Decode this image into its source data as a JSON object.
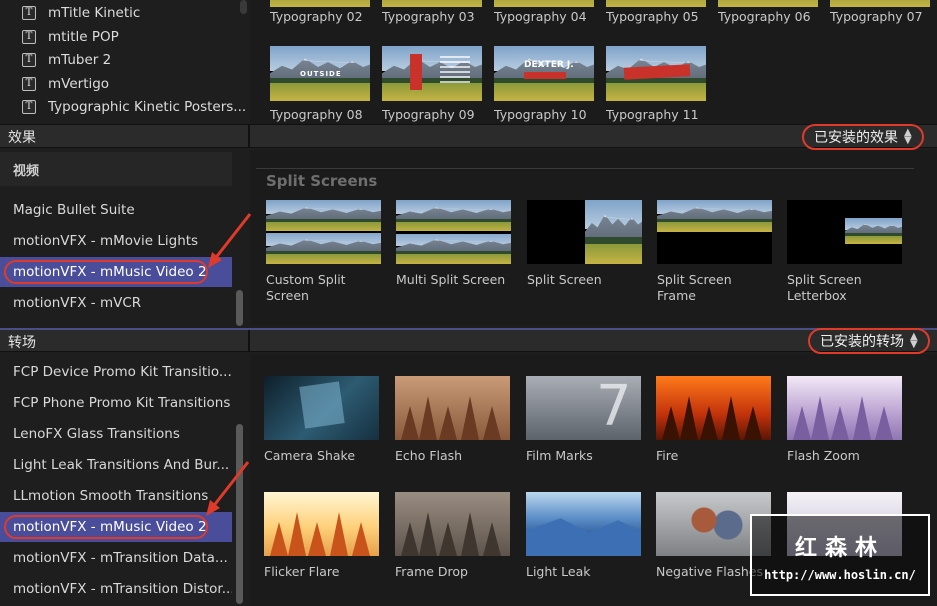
{
  "colors": {
    "accent_red": "#e03a2a",
    "selection": "#4a4e9a",
    "panel": "#1b1b1b",
    "section_bar": "#2b2b2b"
  },
  "titles_list": [
    {
      "icon": "T",
      "label": "mTitle Kinetic"
    },
    {
      "icon": "T",
      "label": "mtitle POP"
    },
    {
      "icon": "T",
      "label": "mTuber 2"
    },
    {
      "icon": "T",
      "label": "mVertigo"
    },
    {
      "icon": "T",
      "label": "Typographic Kinetic Posters..."
    }
  ],
  "typography_row1": [
    "Typography 02",
    "Typography 03",
    "Typography 04",
    "Typography 05",
    "Typography 06",
    "Typography 07"
  ],
  "typography_row2": [
    {
      "label": "Typography 08",
      "overlay": "OUTSIDE"
    },
    {
      "label": "Typography 09",
      "overlay": ""
    },
    {
      "label": "Typography 10",
      "overlay": "DEXTER J."
    },
    {
      "label": "Typography 11",
      "overlay": ""
    }
  ],
  "effects": {
    "section_label": "效果",
    "installed_label": "已安装的效果",
    "sidebar_header": "视频",
    "sidebar_items": [
      {
        "label": "Magic Bullet Suite",
        "selected": false
      },
      {
        "label": "motionVFX - mMovie Lights",
        "selected": false
      },
      {
        "label": "motionVFX - mMusic Video 2",
        "selected": true
      },
      {
        "label": "motionVFX - mVCR",
        "selected": false
      }
    ],
    "category_title": "Split Screens",
    "items": [
      {
        "label_line1": "Custom Split",
        "label_line2": "Screen"
      },
      {
        "label_line1": "Multi Split Screen",
        "label_line2": ""
      },
      {
        "label_line1": "Split Screen",
        "label_line2": ""
      },
      {
        "label_line1": "Split Screen",
        "label_line2": "Frame"
      },
      {
        "label_line1": "Split Screen",
        "label_line2": "Letterbox"
      }
    ]
  },
  "transitions": {
    "section_label": "转场",
    "installed_label": "已安装的转场",
    "sidebar_items": [
      {
        "label": "FCP Device Promo Kit Transitio...",
        "selected": false
      },
      {
        "label": "FCP Phone Promo Kit Transitions",
        "selected": false
      },
      {
        "label": "LenoFX Glass Transitions",
        "selected": false
      },
      {
        "label": "Light Leak Transitions And Bur...",
        "selected": false
      },
      {
        "label": "LLmotion Smooth Transitions",
        "selected": false
      },
      {
        "label": "motionVFX - mMusic Video 2",
        "selected": true
      },
      {
        "label": "motionVFX - mTransition Data...",
        "selected": false
      },
      {
        "label": "motionVFX - mTransition Distor...",
        "selected": false
      }
    ],
    "row1": [
      "Camera Shake",
      "Echo Flash",
      "Film Marks",
      "Fire",
      "Flash Zoom"
    ],
    "row2": [
      "Flicker Flare",
      "Frame Drop",
      "Light Leak",
      "Negative Flashes",
      ""
    ]
  },
  "watermark": {
    "title": "红森林",
    "url": "http://www.hoslin.cn/"
  }
}
